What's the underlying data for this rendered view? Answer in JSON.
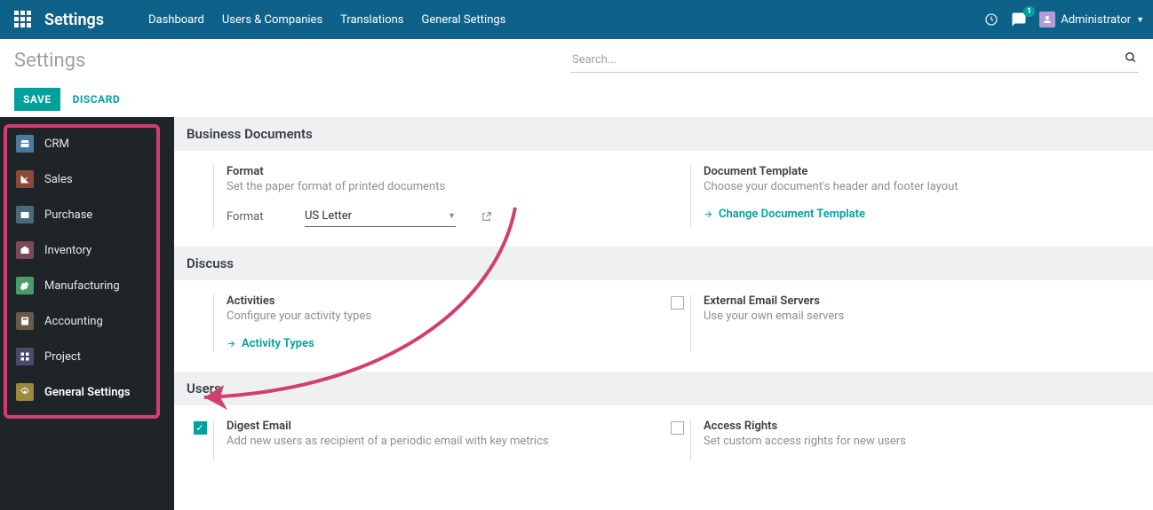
{
  "navbar": {
    "brand": "Settings",
    "menu": [
      "Dashboard",
      "Users & Companies",
      "Translations",
      "General Settings"
    ],
    "chat_badge": "1",
    "user": "Administrator"
  },
  "page": {
    "title": "Settings",
    "search_placeholder": "Search...",
    "save": "SAVE",
    "discard": "DISCARD"
  },
  "sidebar": {
    "items": [
      {
        "label": "CRM",
        "icon_bg": "#4a7a9e"
      },
      {
        "label": "Sales",
        "icon_bg": "#8a4a3a"
      },
      {
        "label": "Purchase",
        "icon_bg": "#4a6a7a"
      },
      {
        "label": "Inventory",
        "icon_bg": "#7a4a5a"
      },
      {
        "label": "Manufacturing",
        "icon_bg": "#4a9a6a"
      },
      {
        "label": "Accounting",
        "icon_bg": "#6a5a4a"
      },
      {
        "label": "Project",
        "icon_bg": "#4a4a6a"
      },
      {
        "label": "General Settings",
        "icon_bg": "#9a8a3a"
      }
    ]
  },
  "sections": {
    "business_docs": {
      "header": "Business Documents",
      "format_title": "Format",
      "format_desc": "Set the paper format of printed documents",
      "format_label": "Format",
      "format_value": "US Letter",
      "template_title": "Document Template",
      "template_desc": "Choose your document's header and footer layout",
      "template_link": "Change Document Template"
    },
    "discuss": {
      "header": "Discuss",
      "activities_title": "Activities",
      "activities_desc": "Configure your activity types",
      "activities_link": "Activity Types",
      "email_title": "External Email Servers",
      "email_desc": "Use your own email servers"
    },
    "users": {
      "header": "Users",
      "digest_title": "Digest Email",
      "digest_desc": "Add new users as recipient of a periodic email with key metrics",
      "access_title": "Access Rights",
      "access_desc": "Set custom access rights for new users"
    }
  }
}
